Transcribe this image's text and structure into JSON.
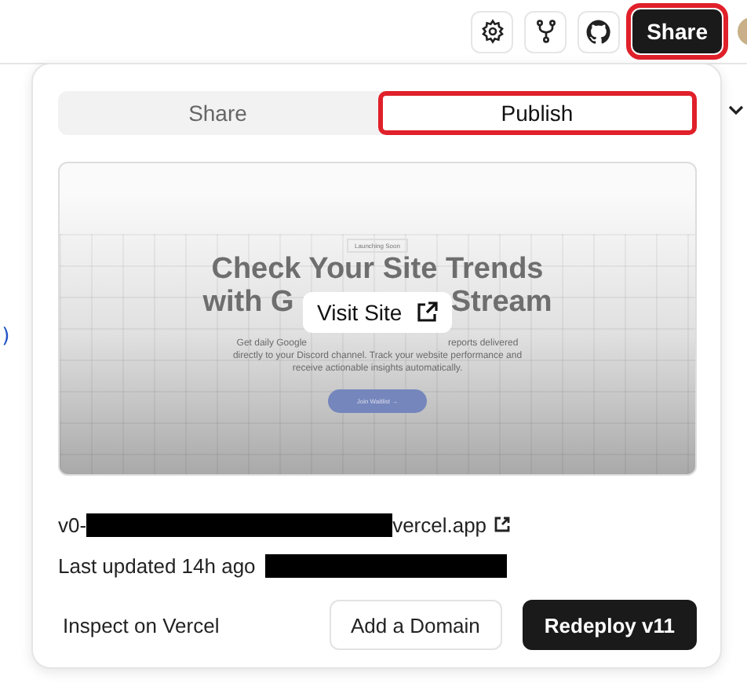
{
  "toolbar": {
    "share_button": {
      "label": "Share",
      "highlighted": true
    }
  },
  "popover": {
    "tabs": [
      {
        "label": "Share",
        "selected": false,
        "highlighted": false
      },
      {
        "label": "Publish",
        "selected": true,
        "highlighted": true
      }
    ],
    "preview": {
      "badge": "Launching Soon",
      "heading_line_1": "Check Your Site Trends",
      "heading_line_2_start": "with G",
      "heading_line_2_end": "Stream",
      "description_start": "Get daily Google",
      "description_end": "reports delivered",
      "description_line_2": "directly to your Discord channel. Track your website performance and",
      "description_line_3": "receive actionable insights automatically.",
      "cta": "Join Waitlist",
      "cta_arrow": "→",
      "visit_button": "Visit Site"
    },
    "url_start": "v0-",
    "url_end": "vercel.app",
    "last_updated": "Last updated 14h ago",
    "inspect_link": "Inspect on Vercel",
    "buttons": [
      {
        "label": "Add a Domain",
        "kind": "secondary"
      },
      {
        "label": "Redeploy v11",
        "kind": "primary"
      }
    ]
  },
  "background": {
    "code_fragment": ")"
  }
}
